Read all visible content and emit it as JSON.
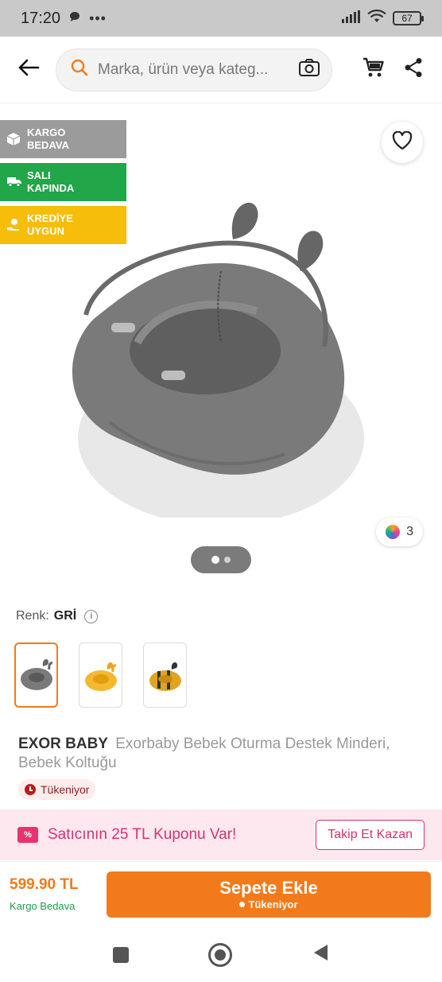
{
  "status_bar": {
    "time": "17:20",
    "battery": "67"
  },
  "header": {
    "search_placeholder": "Marka, ürün veya kateg...",
    "icons": [
      "back-arrow-icon",
      "search-icon",
      "camera-icon",
      "cart-icon",
      "share-icon"
    ]
  },
  "badges": [
    {
      "line1": "KARGO",
      "line2": "BEDAVA",
      "color": "#9b9b9b"
    },
    {
      "line1": "SALI",
      "line2": "KAPINDA",
      "color": "#21a64a"
    },
    {
      "line1": "KREDİYE",
      "line2": "UYGUN",
      "color": "#f7bd0b"
    }
  ],
  "gallery": {
    "review_count": "3",
    "current_page": 1,
    "total_pages": 2
  },
  "color_selector": {
    "label": "Renk:",
    "value": "GRİ"
  },
  "variants": [
    {
      "name": "gray",
      "selected": true,
      "color": "#7a7a7a"
    },
    {
      "name": "yellow",
      "selected": false,
      "color": "#f5b82e"
    },
    {
      "name": "yellow-black",
      "selected": false,
      "color": "#e0a423"
    }
  ],
  "product": {
    "brand": "EXOR BABY",
    "name": "Exorbaby  Bebek Oturma Destek Minderi, Bebek Koltuğu",
    "stock_status": "Tükeniyor"
  },
  "coupon": {
    "text": "Satıcının 25 TL Kuponu Var!",
    "button_label": "Takip Et Kazan",
    "icon_text": "%"
  },
  "buy_bar": {
    "price": "599.90 TL",
    "shipping": "Kargo Bedava",
    "button_label": "Sepete Ekle",
    "button_sub": "Tükeniyor",
    "accent": "#f27a1a"
  }
}
